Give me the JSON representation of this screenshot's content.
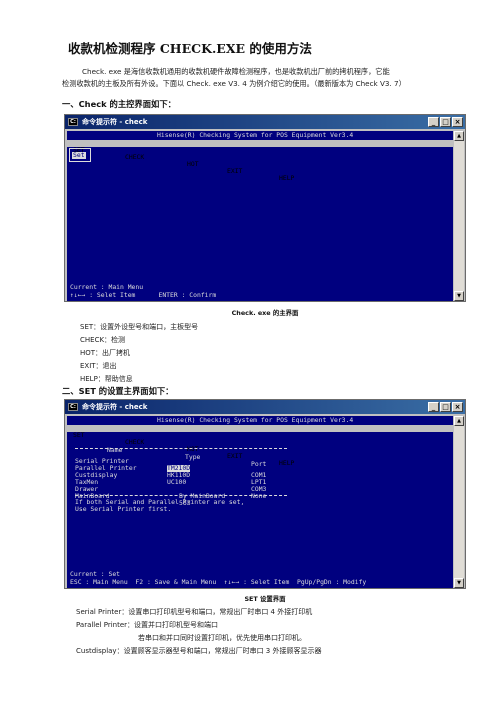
{
  "doc": {
    "title": "收款机检测程序 CHECK.EXE 的使用方法",
    "intro": [
      "Check. exe 是海信收款机通用的收款机硬件故障检测程序，也是收款机出厂前的拷机程序，它能",
      "检测收款机的主板及所有外设。下面以 Check. exe V3. 4 为例介绍它的使用。（最新版本为 Check V3. 7）"
    ],
    "section1_heading": "一、Check 的主控界面如下：",
    "section2_heading": "二、SET 的设置主界面如下：",
    "caption1": "Check. exe 的主界面",
    "caption2": "SET 设置界面",
    "main_desc": [
      "SET：设置外设型号和端口，主板型号",
      "CHECK：检测",
      "HOT：出厂拷机",
      "EXIT：退出",
      "HELP：帮助信息"
    ],
    "set_desc": [
      "Serial Printer：设置串口打印机型号和端口，常规出厂时串口 4 外接打印机",
      "Parallel Printer：设置并口打印机型号和端口",
      "若串口和并口同时设置打印机，优先使用串口打印机。",
      "Custdisplay：设置顾客显示器型号和端口，常规出厂时串口 3 外接顾客显示器"
    ]
  },
  "window1": {
    "title": "命令提示符 - check",
    "buttons": [
      "_",
      "□",
      "×"
    ],
    "banner": "Hisense(R) Checking System for POS Equipment Ver3.4",
    "menu": [
      "SET",
      "CHECK",
      "HOT",
      "EXIT",
      "HELP"
    ],
    "dropdown_item": "Set",
    "status1": "Current : Main Menu",
    "status2": "↑↓←→ : Selet Item      ENTER : Confirm"
  },
  "window2": {
    "title": "命令提示符 - check",
    "buttons": [
      "_",
      "□",
      "×"
    ],
    "banner": "Hisense(R) Checking System for POS Equipment Ver3.4",
    "menu": [
      "SET",
      "CHECK",
      "HOT",
      "EXIT",
      "HELP"
    ],
    "col_headers": [
      "Name",
      "Type",
      "Port"
    ],
    "rows": [
      {
        "name": "Serial Printer",
        "type": "TM210D",
        "port": "COM1"
      },
      {
        "name": "Parallel Printer",
        "type": "HK110D",
        "port": "LPT1"
      },
      {
        "name": "Custdisplay",
        "type": "UC100",
        "port": "COM3"
      },
      {
        "name": "TaxMen",
        "type": "",
        "port": "None"
      },
      {
        "name": "Drawer",
        "type": "By MainBoard",
        "port": ""
      },
      {
        "name": "MainBoard",
        "type": "563",
        "port": ""
      }
    ],
    "note1": "If both Serial and Parallel Printer are set,",
    "note2": "Use Serial Printer first.",
    "status1": "Current : Set",
    "status2": "ESC : Main Menu  F2 : Save & Main Menu  ↑↓←→ : Selet Item  PgUp/PgDn : Modify"
  },
  "colors": {
    "console_bg": "#00007f",
    "titlebar": "#0a246a"
  }
}
